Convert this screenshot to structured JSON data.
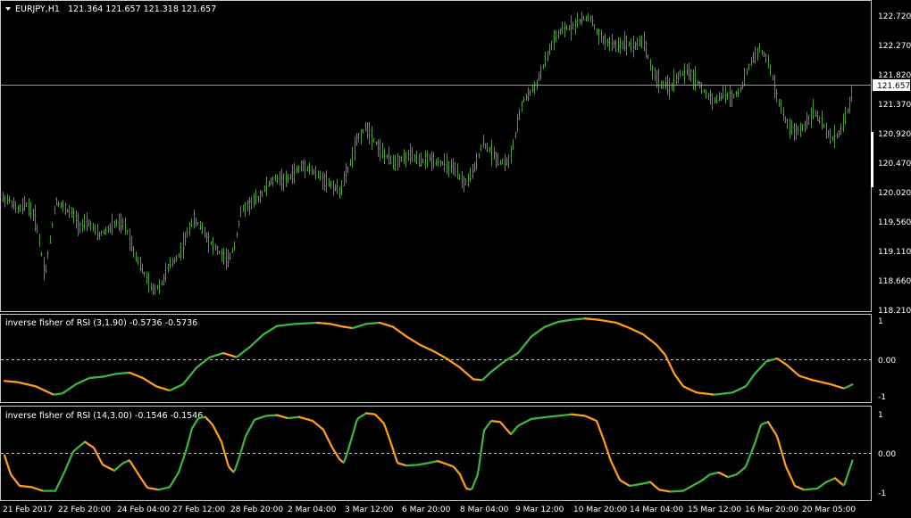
{
  "main": {
    "header": {
      "symbol": "EURJPY,H1",
      "ohlc": "121.364 121.657 121.318 121.657"
    },
    "price_axis": [
      "122.720",
      "122.270",
      "121.820",
      "121.370",
      "120.920",
      "120.470",
      "120.020",
      "119.560",
      "119.110",
      "118.660",
      "118.210"
    ],
    "current_price": "121.657"
  },
  "indicator1": {
    "title": "inverse fisher of RSI (3,1.90) -0.5736 -0.5736",
    "axis": [
      "1",
      "0.00",
      "-1"
    ]
  },
  "indicator2": {
    "title": "inverse fisher of RSI (14,3.00) -0.1546 -0.1546",
    "axis": [
      "1",
      "0.00",
      "-1"
    ]
  },
  "time_axis": [
    "21 Feb 2017",
    "22 Feb 20:00",
    "24 Feb 04:00",
    "27 Feb 12:00",
    "28 Feb 20:00",
    "2 Mar 04:00",
    "3 Mar 12:00",
    "6 Mar 20:00",
    "8 Mar 04:00",
    "9 Mar 12:00",
    "10 Mar 20:00",
    "14 Mar 04:00",
    "15 Mar 12:00",
    "16 Mar 20:00",
    "20 Mar 05:00"
  ],
  "colors": {
    "background": "#000000",
    "bar": "#4f9a3a",
    "rising": "#3cb83c",
    "falling": "#ff9d1c",
    "grid": "#c8c8c8"
  },
  "chart_data": [
    {
      "type": "bar",
      "title": "EURJPY,H1",
      "ylim": [
        118.21,
        122.9
      ],
      "anchors": [
        [
          0,
          119.95
        ],
        [
          10,
          119.9
        ],
        [
          20,
          119.75
        ],
        [
          30,
          119.85
        ],
        [
          40,
          119.6
        ],
        [
          50,
          118.75
        ],
        [
          55,
          119.2
        ],
        [
          62,
          119.9
        ],
        [
          70,
          119.8
        ],
        [
          80,
          119.7
        ],
        [
          90,
          119.5
        ],
        [
          100,
          119.55
        ],
        [
          110,
          119.35
        ],
        [
          120,
          119.45
        ],
        [
          130,
          119.55
        ],
        [
          140,
          119.5
        ],
        [
          150,
          119.1
        ],
        [
          160,
          118.8
        ],
        [
          170,
          118.5
        ],
        [
          180,
          118.6
        ],
        [
          190,
          118.9
        ],
        [
          200,
          119.05
        ],
        [
          210,
          119.4
        ],
        [
          215,
          119.6
        ],
        [
          225,
          119.5
        ],
        [
          235,
          119.25
        ],
        [
          245,
          119.1
        ],
        [
          255,
          118.95
        ],
        [
          262,
          119.2
        ],
        [
          270,
          119.75
        ],
        [
          280,
          119.85
        ],
        [
          290,
          119.95
        ],
        [
          300,
          120.15
        ],
        [
          310,
          120.25
        ],
        [
          320,
          120.2
        ],
        [
          330,
          120.35
        ],
        [
          340,
          120.45
        ],
        [
          350,
          120.35
        ],
        [
          360,
          120.25
        ],
        [
          370,
          120.15
        ],
        [
          380,
          120.05
        ],
        [
          390,
          120.4
        ],
        [
          400,
          120.85
        ],
        [
          410,
          121.05
        ],
        [
          420,
          120.8
        ],
        [
          430,
          120.6
        ],
        [
          440,
          120.5
        ],
        [
          450,
          120.55
        ],
        [
          460,
          120.6
        ],
        [
          470,
          120.5
        ],
        [
          480,
          120.55
        ],
        [
          490,
          120.5
        ],
        [
          500,
          120.45
        ],
        [
          510,
          120.35
        ],
        [
          520,
          120.15
        ],
        [
          530,
          120.35
        ],
        [
          540,
          120.8
        ],
        [
          550,
          120.65
        ],
        [
          560,
          120.5
        ],
        [
          570,
          120.5
        ],
        [
          578,
          121.0
        ],
        [
          585,
          121.45
        ],
        [
          592,
          121.55
        ],
        [
          600,
          121.7
        ],
        [
          610,
          122.05
        ],
        [
          620,
          122.4
        ],
        [
          630,
          122.55
        ],
        [
          640,
          122.6
        ],
        [
          650,
          122.7
        ],
        [
          660,
          122.75
        ],
        [
          670,
          122.45
        ],
        [
          680,
          122.35
        ],
        [
          690,
          122.3
        ],
        [
          700,
          122.35
        ],
        [
          710,
          122.3
        ],
        [
          720,
          122.4
        ],
        [
          730,
          121.9
        ],
        [
          740,
          121.7
        ],
        [
          750,
          121.65
        ],
        [
          760,
          121.85
        ],
        [
          770,
          121.9
        ],
        [
          780,
          121.75
        ],
        [
          790,
          121.55
        ],
        [
          800,
          121.45
        ],
        [
          810,
          121.55
        ],
        [
          820,
          121.5
        ],
        [
          830,
          121.65
        ],
        [
          840,
          122.05
        ],
        [
          850,
          122.25
        ],
        [
          860,
          122.05
        ],
        [
          870,
          121.5
        ],
        [
          880,
          121.1
        ],
        [
          890,
          120.95
        ],
        [
          900,
          121.05
        ],
        [
          910,
          121.3
        ],
        [
          920,
          121.1
        ],
        [
          930,
          120.85
        ],
        [
          940,
          120.95
        ],
        [
          950,
          121.35
        ],
        [
          955,
          121.6
        ]
      ]
    },
    {
      "type": "line",
      "title": "inverse fisher of RSI (3,1.90)",
      "ylim": [
        -1.05,
        1.05
      ],
      "anchors": [
        [
          5,
          -0.52
        ],
        [
          20,
          -0.55
        ],
        [
          40,
          -0.65
        ],
        [
          60,
          -0.85
        ],
        [
          70,
          -0.82
        ],
        [
          85,
          -0.6
        ],
        [
          100,
          -0.45
        ],
        [
          115,
          -0.42
        ],
        [
          130,
          -0.35
        ],
        [
          145,
          -0.32
        ],
        [
          160,
          -0.45
        ],
        [
          175,
          -0.65
        ],
        [
          190,
          -0.75
        ],
        [
          205,
          -0.6
        ],
        [
          220,
          -0.2
        ],
        [
          235,
          0.05
        ],
        [
          250,
          0.15
        ],
        [
          265,
          0.05
        ],
        [
          280,
          0.3
        ],
        [
          295,
          0.6
        ],
        [
          310,
          0.8
        ],
        [
          330,
          0.85
        ],
        [
          355,
          0.88
        ],
        [
          370,
          0.85
        ],
        [
          385,
          0.78
        ],
        [
          395,
          0.75
        ],
        [
          410,
          0.85
        ],
        [
          425,
          0.88
        ],
        [
          440,
          0.78
        ],
        [
          455,
          0.55
        ],
        [
          470,
          0.35
        ],
        [
          485,
          0.2
        ],
        [
          500,
          0.02
        ],
        [
          515,
          -0.2
        ],
        [
          530,
          -0.48
        ],
        [
          540,
          -0.5
        ],
        [
          550,
          -0.3
        ],
        [
          565,
          -0.05
        ],
        [
          580,
          0.15
        ],
        [
          595,
          0.55
        ],
        [
          610,
          0.78
        ],
        [
          625,
          0.9
        ],
        [
          640,
          0.95
        ],
        [
          655,
          0.98
        ],
        [
          670,
          0.95
        ],
        [
          690,
          0.88
        ],
        [
          705,
          0.75
        ],
        [
          720,
          0.6
        ],
        [
          735,
          0.35
        ],
        [
          745,
          0.1
        ],
        [
          755,
          -0.35
        ],
        [
          765,
          -0.65
        ],
        [
          780,
          -0.8
        ],
        [
          800,
          -0.85
        ],
        [
          820,
          -0.8
        ],
        [
          835,
          -0.65
        ],
        [
          845,
          -0.35
        ],
        [
          858,
          -0.05
        ],
        [
          870,
          0.02
        ],
        [
          880,
          -0.12
        ],
        [
          895,
          -0.4
        ],
        [
          910,
          -0.5
        ],
        [
          930,
          -0.6
        ],
        [
          945,
          -0.7
        ],
        [
          955,
          -0.6
        ]
      ]
    },
    {
      "type": "line",
      "title": "inverse fisher of RSI (14,3.00)",
      "ylim": [
        -1.2,
        1.2
      ],
      "anchors": [
        [
          5,
          -0.05
        ],
        [
          12,
          -0.55
        ],
        [
          22,
          -0.85
        ],
        [
          35,
          -0.88
        ],
        [
          48,
          -0.98
        ],
        [
          62,
          -0.98
        ],
        [
          72,
          -0.5
        ],
        [
          82,
          0.05
        ],
        [
          95,
          0.3
        ],
        [
          105,
          0.15
        ],
        [
          115,
          -0.3
        ],
        [
          128,
          -0.45
        ],
        [
          138,
          -0.25
        ],
        [
          145,
          -0.18
        ],
        [
          155,
          -0.55
        ],
        [
          165,
          -0.9
        ],
        [
          178,
          -0.95
        ],
        [
          190,
          -0.88
        ],
        [
          200,
          -0.5
        ],
        [
          208,
          0.05
        ],
        [
          215,
          0.65
        ],
        [
          222,
          0.92
        ],
        [
          230,
          0.95
        ],
        [
          238,
          0.75
        ],
        [
          248,
          0.3
        ],
        [
          256,
          -0.35
        ],
        [
          262,
          -0.5
        ],
        [
          268,
          -0.1
        ],
        [
          275,
          0.45
        ],
        [
          285,
          0.88
        ],
        [
          298,
          0.98
        ],
        [
          310,
          1.0
        ],
        [
          322,
          0.92
        ],
        [
          335,
          0.95
        ],
        [
          350,
          0.85
        ],
        [
          362,
          0.62
        ],
        [
          372,
          0.15
        ],
        [
          380,
          -0.15
        ],
        [
          385,
          -0.25
        ],
        [
          390,
          0.1
        ],
        [
          400,
          0.9
        ],
        [
          410,
          1.05
        ],
        [
          420,
          1.02
        ],
        [
          430,
          0.78
        ],
        [
          438,
          0.25
        ],
        [
          445,
          -0.25
        ],
        [
          455,
          -0.32
        ],
        [
          468,
          -0.3
        ],
        [
          480,
          -0.25
        ],
        [
          490,
          -0.2
        ],
        [
          500,
          -0.28
        ],
        [
          508,
          -0.35
        ],
        [
          515,
          -0.55
        ],
        [
          522,
          -0.92
        ],
        [
          528,
          -0.95
        ],
        [
          535,
          -0.55
        ],
        [
          542,
          0.6
        ],
        [
          550,
          0.85
        ],
        [
          560,
          0.82
        ],
        [
          572,
          0.5
        ],
        [
          580,
          0.72
        ],
        [
          595,
          0.9
        ],
        [
          612,
          0.95
        ],
        [
          625,
          0.98
        ],
        [
          640,
          1.02
        ],
        [
          655,
          0.98
        ],
        [
          668,
          0.85
        ],
        [
          676,
          0.35
        ],
        [
          684,
          -0.2
        ],
        [
          694,
          -0.7
        ],
        [
          705,
          -0.85
        ],
        [
          718,
          -0.8
        ],
        [
          728,
          -0.75
        ],
        [
          738,
          -0.95
        ],
        [
          750,
          -1.0
        ],
        [
          765,
          -0.98
        ],
        [
          775,
          -0.85
        ],
        [
          785,
          -0.72
        ],
        [
          795,
          -0.55
        ],
        [
          805,
          -0.5
        ],
        [
          815,
          -0.62
        ],
        [
          825,
          -0.55
        ],
        [
          835,
          -0.35
        ],
        [
          845,
          0.25
        ],
        [
          852,
          0.75
        ],
        [
          860,
          0.82
        ],
        [
          870,
          0.45
        ],
        [
          880,
          -0.35
        ],
        [
          890,
          -0.85
        ],
        [
          900,
          -0.95
        ],
        [
          915,
          -0.92
        ],
        [
          925,
          -0.75
        ],
        [
          935,
          -0.65
        ],
        [
          945,
          -0.85
        ],
        [
          955,
          -0.15
        ]
      ]
    }
  ]
}
